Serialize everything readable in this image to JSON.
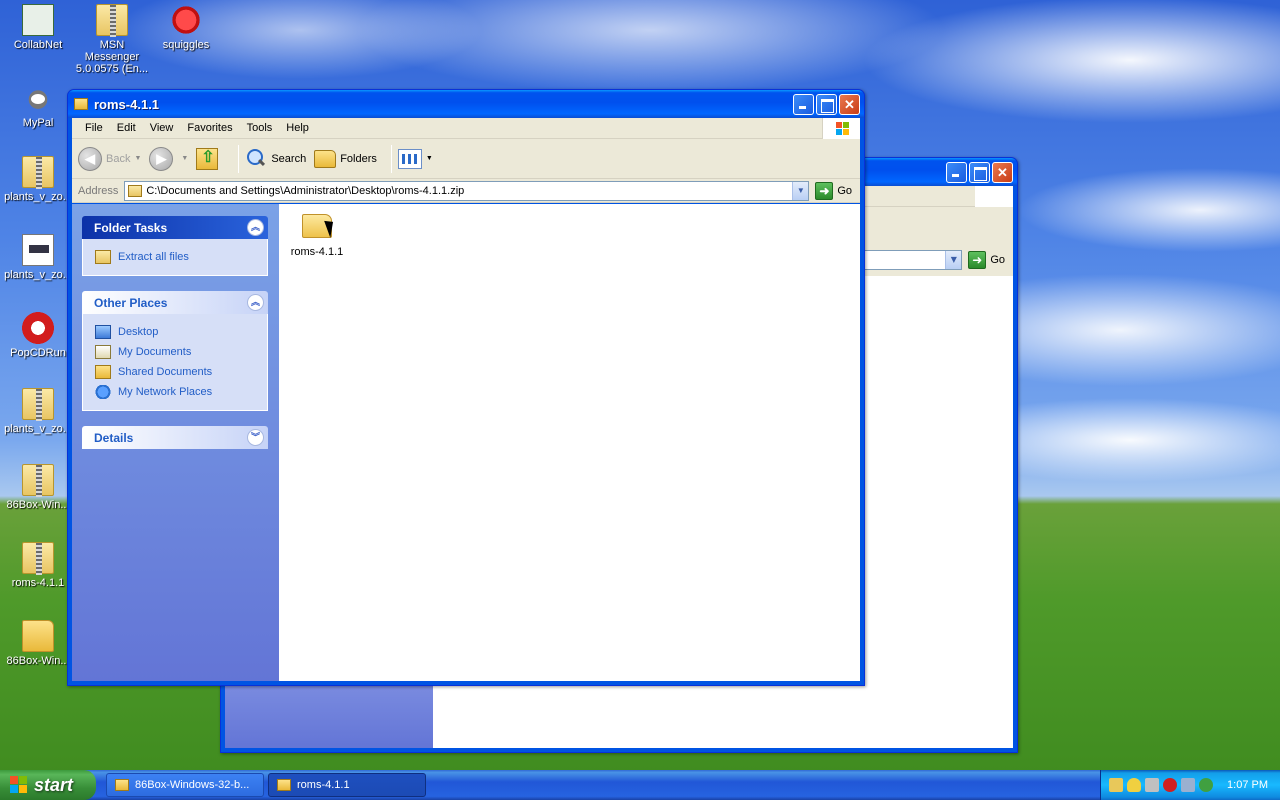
{
  "desktop": {
    "icons": [
      {
        "label": "CollabNet",
        "icon": "app-icon"
      },
      {
        "label": "MSN Messenger 5.0.0575 (En...",
        "icon": "zip-icon"
      },
      {
        "label": "squiggles",
        "icon": "red-circle-icon"
      },
      {
        "label": "MyPal",
        "icon": "mypal-icon"
      },
      {
        "label": "plants_v_zo...",
        "icon": "zip-icon"
      },
      {
        "label": "plants_v_zo...",
        "icon": "document-icon"
      },
      {
        "label": "PopCDRun",
        "icon": "popcd-icon"
      },
      {
        "label": "plants_v_zo...",
        "icon": "zip-icon"
      },
      {
        "label": "86Box-Win...",
        "icon": "zip-icon"
      },
      {
        "label": "roms-4.1.1",
        "icon": "zip-icon"
      },
      {
        "label": "86Box-Win...",
        "icon": "folder-icon"
      }
    ]
  },
  "background_window": {
    "go_label": "Go"
  },
  "window": {
    "title": "roms-4.1.1",
    "menu": [
      "File",
      "Edit",
      "View",
      "Favorites",
      "Tools",
      "Help"
    ],
    "toolbar": {
      "back": "Back",
      "search": "Search",
      "folders": "Folders"
    },
    "address": {
      "label": "Address",
      "value": "C:\\Documents and Settings\\Administrator\\Desktop\\roms-4.1.1.zip",
      "go": "Go"
    },
    "taskpane": {
      "folder_tasks": {
        "title": "Folder Tasks",
        "items": [
          "Extract all files"
        ]
      },
      "other_places": {
        "title": "Other Places",
        "items": [
          "Desktop",
          "My Documents",
          "Shared Documents",
          "My Network Places"
        ]
      },
      "details": {
        "title": "Details"
      }
    },
    "files": [
      {
        "name": "roms-4.1.1",
        "type": "folder"
      }
    ]
  },
  "taskbar": {
    "start_label": "start",
    "tasks": [
      {
        "label": "86Box-Windows-32-b...",
        "active": false
      },
      {
        "label": "roms-4.1.1",
        "active": true
      }
    ],
    "clock": "1:07 PM"
  }
}
